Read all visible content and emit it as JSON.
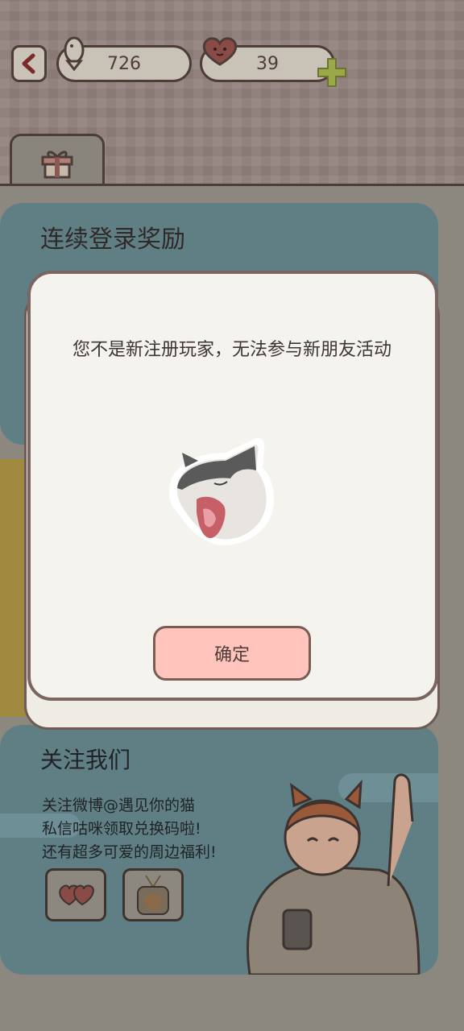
{
  "header": {
    "fish_count": "726",
    "heart_count": "39",
    "icons": [
      "back-arrow-icon",
      "fish-icon",
      "heart-face-icon",
      "plus-icon",
      "gift-icon"
    ]
  },
  "cards": {
    "login_reward_title": "连续登录奖励",
    "follow": {
      "title": "关注我们",
      "lines": [
        "关注微博@遇见你的猫",
        "私信咕咪领取兑换码啦!",
        "还有超多可爱的周边福利!"
      ]
    }
  },
  "modal": {
    "message": "您不是新注册玩家，无法参与新朋友活动",
    "confirm_label": "确定"
  },
  "colors": {
    "accent_button": "#ffc4bc",
    "plus_green": "#9aa84a",
    "outline": "#4e3c38"
  }
}
